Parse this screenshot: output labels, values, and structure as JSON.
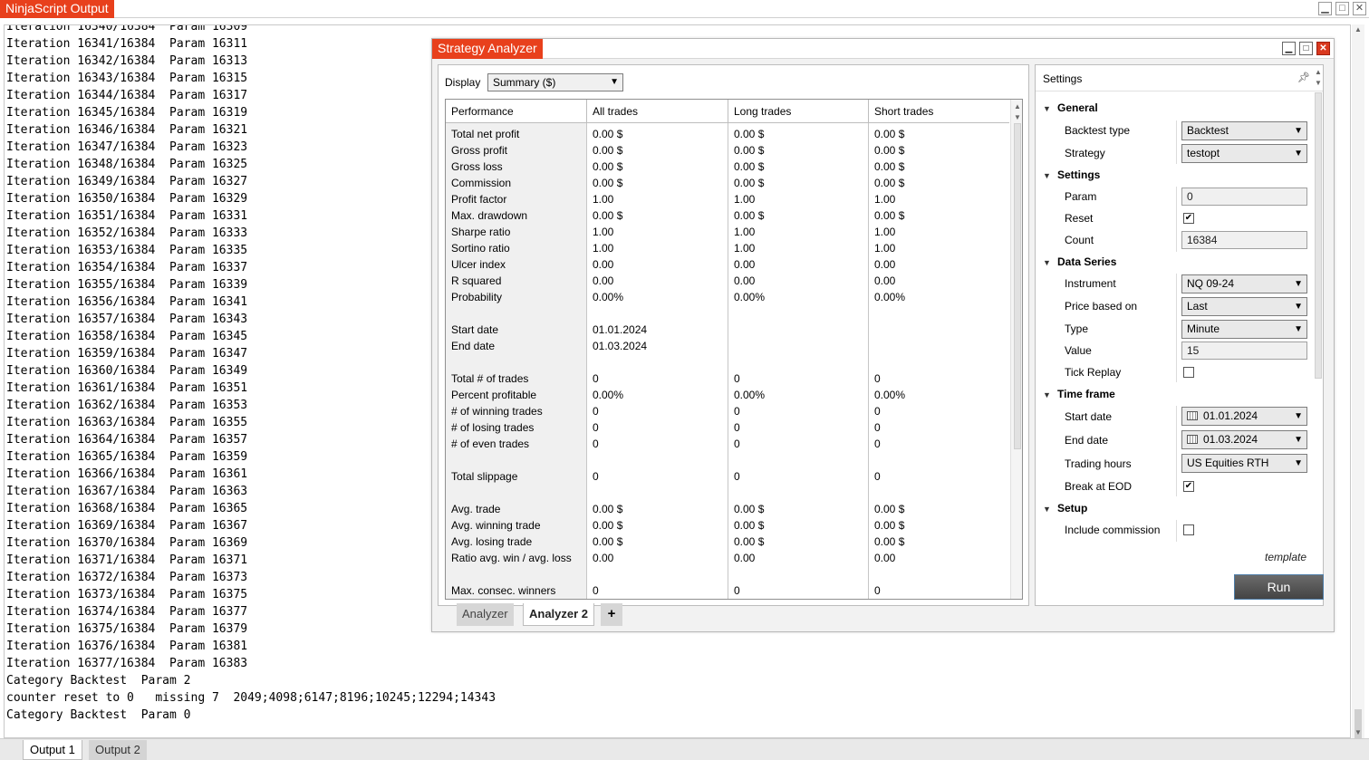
{
  "main_window": {
    "title": "NinjaScript Output",
    "minimize_glyph": "▁",
    "maximize_glyph": "□",
    "close_glyph": "✕"
  },
  "output_log": {
    "lines": [
      "Iteration 16340/16384  Param 16309",
      "Iteration 16341/16384  Param 16311",
      "Iteration 16342/16384  Param 16313",
      "Iteration 16343/16384  Param 16315",
      "Iteration 16344/16384  Param 16317",
      "Iteration 16345/16384  Param 16319",
      "Iteration 16346/16384  Param 16321",
      "Iteration 16347/16384  Param 16323",
      "Iteration 16348/16384  Param 16325",
      "Iteration 16349/16384  Param 16327",
      "Iteration 16350/16384  Param 16329",
      "Iteration 16351/16384  Param 16331",
      "Iteration 16352/16384  Param 16333",
      "Iteration 16353/16384  Param 16335",
      "Iteration 16354/16384  Param 16337",
      "Iteration 16355/16384  Param 16339",
      "Iteration 16356/16384  Param 16341",
      "Iteration 16357/16384  Param 16343",
      "Iteration 16358/16384  Param 16345",
      "Iteration 16359/16384  Param 16347",
      "Iteration 16360/16384  Param 16349",
      "Iteration 16361/16384  Param 16351",
      "Iteration 16362/16384  Param 16353",
      "Iteration 16363/16384  Param 16355",
      "Iteration 16364/16384  Param 16357",
      "Iteration 16365/16384  Param 16359",
      "Iteration 16366/16384  Param 16361",
      "Iteration 16367/16384  Param 16363",
      "Iteration 16368/16384  Param 16365",
      "Iteration 16369/16384  Param 16367",
      "Iteration 16370/16384  Param 16369",
      "Iteration 16371/16384  Param 16371",
      "Iteration 16372/16384  Param 16373",
      "Iteration 16373/16384  Param 16375",
      "Iteration 16374/16384  Param 16377",
      "Iteration 16375/16384  Param 16379",
      "Iteration 16376/16384  Param 16381",
      "Iteration 16377/16384  Param 16383",
      "Category Backtest  Param 2",
      "counter reset to 0   missing 7  2049;4098;6147;8196;10245;12294;14343",
      "Category Backtest  Param 0"
    ]
  },
  "output_tabs": [
    "Output 1",
    "Output 2"
  ],
  "strategy_analyzer": {
    "title": "Strategy Analyzer",
    "display_label": "Display",
    "display_value": "Summary ($)",
    "columns": [
      "Performance",
      "All trades",
      "Long trades",
      "Short trades"
    ],
    "rows": [
      [
        "Total net profit",
        "0.00 $",
        "0.00 $",
        "0.00 $"
      ],
      [
        "Gross profit",
        "0.00 $",
        "0.00 $",
        "0.00 $"
      ],
      [
        "Gross loss",
        "0.00 $",
        "0.00 $",
        "0.00 $"
      ],
      [
        "Commission",
        "0.00 $",
        "0.00 $",
        "0.00 $"
      ],
      [
        "Profit factor",
        "1.00",
        "1.00",
        "1.00"
      ],
      [
        "Max. drawdown",
        "0.00 $",
        "0.00 $",
        "0.00 $"
      ],
      [
        "Sharpe ratio",
        "1.00",
        "1.00",
        "1.00"
      ],
      [
        "Sortino ratio",
        "1.00",
        "1.00",
        "1.00"
      ],
      [
        "Ulcer index",
        "0.00",
        "0.00",
        "0.00"
      ],
      [
        "R squared",
        "0.00",
        "0.00",
        "0.00"
      ],
      [
        "Probability",
        "0.00%",
        "0.00%",
        "0.00%"
      ],
      [
        "",
        "",
        "",
        ""
      ],
      [
        "Start date",
        "01.01.2024",
        "",
        ""
      ],
      [
        "End date",
        "01.03.2024",
        "",
        ""
      ],
      [
        "",
        "",
        "",
        ""
      ],
      [
        "Total # of trades",
        "0",
        "0",
        "0"
      ],
      [
        "Percent profitable",
        "0.00%",
        "0.00%",
        "0.00%"
      ],
      [
        "# of winning trades",
        "0",
        "0",
        "0"
      ],
      [
        "# of losing trades",
        "0",
        "0",
        "0"
      ],
      [
        "# of even trades",
        "0",
        "0",
        "0"
      ],
      [
        "",
        "",
        "",
        ""
      ],
      [
        "Total slippage",
        "0",
        "0",
        "0"
      ],
      [
        "",
        "",
        "",
        ""
      ],
      [
        "Avg. trade",
        "0.00 $",
        "0.00 $",
        "0.00 $"
      ],
      [
        "Avg. winning trade",
        "0.00 $",
        "0.00 $",
        "0.00 $"
      ],
      [
        "Avg. losing trade",
        "0.00 $",
        "0.00 $",
        "0.00 $"
      ],
      [
        "Ratio avg. win / avg. loss",
        "0.00",
        "0.00",
        "0.00"
      ],
      [
        "",
        "",
        "",
        ""
      ],
      [
        "Max. consec. winners",
        "0",
        "0",
        "0"
      ]
    ],
    "tabs": [
      "Analyzer",
      "Analyzer 2"
    ],
    "add_tab_label": "+",
    "settings": {
      "title": "Settings",
      "sections": {
        "general": "General",
        "settings": "Settings",
        "data_series": "Data Series",
        "time_frame": "Time frame",
        "setup": "Setup"
      },
      "labels": {
        "backtest_type": "Backtest type",
        "strategy": "Strategy",
        "param": "Param",
        "reset": "Reset",
        "count": "Count",
        "instrument": "Instrument",
        "price_based_on": "Price based on",
        "type": "Type",
        "value": "Value",
        "tick_replay": "Tick Replay",
        "start_date": "Start date",
        "end_date": "End date",
        "trading_hours": "Trading hours",
        "break_at_eod": "Break at EOD",
        "include_commission": "Include commission"
      },
      "values": {
        "backtest_type": "Backtest",
        "strategy": "testopt",
        "param": "0",
        "reset": true,
        "count": "16384",
        "instrument": "NQ 09-24",
        "price_based_on": "Last",
        "type": "Minute",
        "value": "15",
        "tick_replay": false,
        "start_date": "01.01.2024",
        "end_date": "01.03.2024",
        "trading_hours": "US Equities RTH",
        "break_at_eod": true,
        "include_commission": false
      },
      "template_label": "template",
      "run_label": "Run"
    }
  },
  "colors": {
    "title_accent": "#e8401c",
    "run_button": "#555555"
  }
}
